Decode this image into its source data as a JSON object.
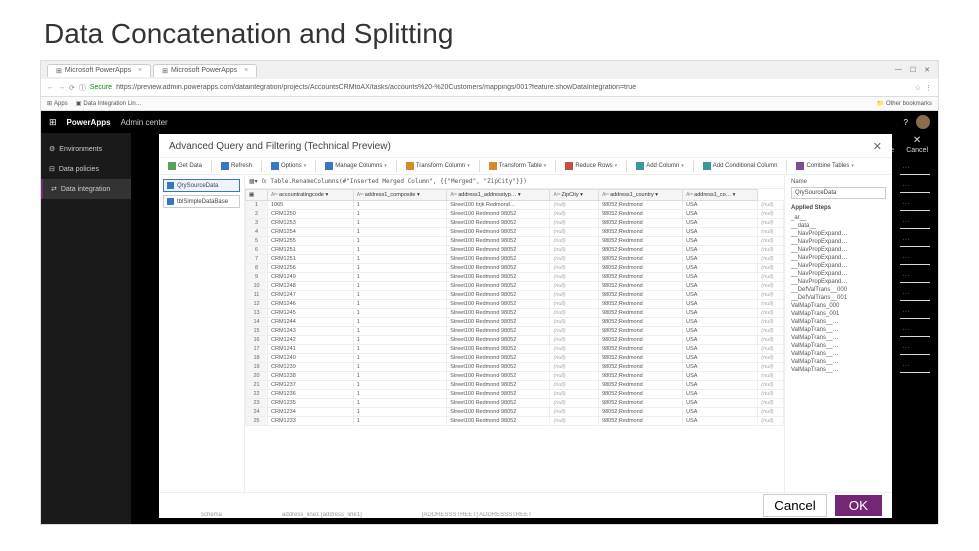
{
  "slide": {
    "title": "Data Concatenation and Splitting"
  },
  "browser": {
    "tabs": [
      {
        "label": "Microsoft PowerApps",
        "icon": "⊞"
      },
      {
        "label": "Microsoft PowerApps",
        "icon": "⊞"
      }
    ],
    "window_controls": {
      "min": "—",
      "max": "☐",
      "close": "✕"
    },
    "nav": {
      "back": "←",
      "forward": "→",
      "reload": "⟳",
      "secure": "Secure",
      "url": "https://preview.admin.powerapps.com/dataintegration/projects/AccountsCRMtoAX/tasks/accounts%20-%20Customers/mappings/001?feature.showDataIntegration=true",
      "star": "☆",
      "menu": "⋮"
    },
    "bookmarks": [
      {
        "icon": "⊞",
        "label": "Apps"
      },
      {
        "icon": "▣",
        "label": "Data Integration Lin…"
      }
    ],
    "other_bm": "Other bookmarks"
  },
  "app": {
    "brand": "PowerApps",
    "section": "Admin center",
    "help": "?",
    "nav": [
      {
        "icon": "⚙",
        "label": "Environments"
      },
      {
        "icon": "⊟",
        "label": "Data policies"
      },
      {
        "icon": "⇄",
        "label": "Data integration"
      }
    ],
    "float_actions": {
      "save": {
        "icon": "✓",
        "label": "Save"
      },
      "cancel": {
        "icon": "✕",
        "label": "Cancel"
      }
    }
  },
  "modal": {
    "title": "Advanced Query and Filtering (Technical Preview)",
    "close": "✕",
    "toolbar": [
      {
        "label": "Get Data",
        "color": "ico-green"
      },
      {
        "label": "Refresh",
        "color": "ico-blue"
      },
      {
        "label": "Options",
        "color": "ico-blue",
        "dd": true
      },
      {
        "label": "Manage Columns",
        "color": "ico-blue",
        "dd": true
      },
      {
        "label": "Transform Column",
        "color": "ico-orange",
        "dd": true
      },
      {
        "label": "Transform Table",
        "color": "ico-orange",
        "dd": true
      },
      {
        "label": "Reduce Rows",
        "color": "ico-red",
        "dd": true
      },
      {
        "label": "Add Column",
        "color": "ico-teal",
        "dd": true
      },
      {
        "label": "Add Conditional Column",
        "color": "ico-teal"
      },
      {
        "label": "Combine Tables",
        "color": "ico-purple",
        "dd": true
      }
    ],
    "sources": [
      {
        "name": "QrySourceData",
        "selected": true
      },
      {
        "name": "tblSimpleDataBase",
        "selected": false
      }
    ],
    "formula": "Table.RenameColumns(#\"Inserted Merged Column\", {{\"Merged\", \"ZipCity\"}})",
    "columns": [
      "",
      "accountratingcode",
      "address1_composite",
      "address1_addresstyp…",
      "ZipCity",
      "address1_country",
      "address1_co…"
    ],
    "rows": [
      [
        "1",
        "1065",
        "1",
        "Street100 hrjk Redmond…",
        "(null)",
        "98052;Redmond",
        "USA",
        "(null)"
      ],
      [
        "2",
        "CRM1250",
        "1",
        "Street100 Redmond 98052",
        "(null)",
        "98052;Redmond",
        "USA",
        "(null)"
      ],
      [
        "3",
        "CRM1253",
        "1",
        "Street100 Redmond 98052",
        "(null)",
        "98052;Redmond",
        "USA",
        "(null)"
      ],
      [
        "4",
        "CRM1254",
        "1",
        "Street100 Redmond 98052",
        "(null)",
        "98052;Redmond",
        "USA",
        "(null)"
      ],
      [
        "5",
        "CRM1255",
        "1",
        "Street100 Redmond 98052",
        "(null)",
        "98052;Redmond",
        "USA",
        "(null)"
      ],
      [
        "6",
        "CRM1251",
        "1",
        "Street100 Redmond 98052",
        "(null)",
        "98052;Redmond",
        "USA",
        "(null)"
      ],
      [
        "7",
        "CRM1251",
        "1",
        "Street100 Redmond 98052",
        "(null)",
        "98052;Redmond",
        "USA",
        "(null)"
      ],
      [
        "8",
        "CRM1256",
        "1",
        "Street100 Redmond 98052",
        "(null)",
        "98052;Redmond",
        "USA",
        "(null)"
      ],
      [
        "9",
        "CRM1249",
        "1",
        "Street100 Redmond 98052",
        "(null)",
        "98052;Redmond",
        "USA",
        "(null)"
      ],
      [
        "10",
        "CRM1248",
        "1",
        "Street100 Redmond 98052",
        "(null)",
        "98052;Redmond",
        "USA",
        "(null)"
      ],
      [
        "11",
        "CRM1247",
        "1",
        "Street100 Redmond 98052",
        "(null)",
        "98052;Redmond",
        "USA",
        "(null)"
      ],
      [
        "12",
        "CRM1246",
        "1",
        "Street100 Redmond 98052",
        "(null)",
        "98052;Redmond",
        "USA",
        "(null)"
      ],
      [
        "13",
        "CRM1245",
        "1",
        "Street100 Redmond 98052",
        "(null)",
        "98052;Redmond",
        "USA",
        "(null)"
      ],
      [
        "14",
        "CRM1244",
        "1",
        "Street100 Redmond 98052",
        "(null)",
        "98052;Redmond",
        "USA",
        "(null)"
      ],
      [
        "15",
        "CRM1243",
        "1",
        "Street100 Redmond 98052",
        "(null)",
        "98052;Redmond",
        "USA",
        "(null)"
      ],
      [
        "16",
        "CRM1242",
        "1",
        "Street100 Redmond 98052",
        "(null)",
        "98052;Redmond",
        "USA",
        "(null)"
      ],
      [
        "17",
        "CRM1241",
        "1",
        "Street100 Redmond 98052",
        "(null)",
        "98052;Redmond",
        "USA",
        "(null)"
      ],
      [
        "18",
        "CRM1240",
        "1",
        "Street100 Redmond 98052",
        "(null)",
        "98052;Redmond",
        "USA",
        "(null)"
      ],
      [
        "19",
        "CRM1239",
        "1",
        "Street100 Redmond 98052",
        "(null)",
        "98052;Redmond",
        "USA",
        "(null)"
      ],
      [
        "20",
        "CRM1238",
        "1",
        "Street100 Redmond 98052",
        "(null)",
        "98052;Redmond",
        "USA",
        "(null)"
      ],
      [
        "21",
        "CRM1237",
        "1",
        "Street100 Redmond 98052",
        "(null)",
        "98052;Redmond",
        "USA",
        "(null)"
      ],
      [
        "22",
        "CRM1236",
        "1",
        "Street100 Redmond 98052",
        "(null)",
        "98052;Redmond",
        "USA",
        "(null)"
      ],
      [
        "23",
        "CRM1235",
        "1",
        "Street100 Redmond 98052",
        "(null)",
        "98052;Redmond",
        "USA",
        "(null)"
      ],
      [
        "24",
        "CRM1234",
        "1",
        "Street100 Redmond 98052",
        "(null)",
        "98052;Redmond",
        "USA",
        "(null)"
      ],
      [
        "25",
        "CRM1233",
        "1",
        "Street100 Redmond 98052",
        "(null)",
        "98052;Redmond",
        "USA",
        "(null)"
      ]
    ],
    "right": {
      "name_label": "Name",
      "name_value": "QrySourceData",
      "steps_label": "Applied Steps",
      "steps": [
        "     _ar__",
        "     __data__",
        "     __NavPropExpand…",
        "     __NavPropExpand…",
        "     __NavPropExpand…",
        "     __NavPropExpand…",
        "     __NavPropExpand…",
        "     __NavPropExpand…",
        "     __NavPropExpand…",
        "     __DefValTrans__000",
        "     __DefValTrans__001",
        "     ValMapTrans_000",
        "     ValMapTrans_001",
        "     ValMapTrans__…",
        "     ValMapTrans__…",
        "     ValMapTrans__…",
        "     ValMapTrans__…",
        "     ValMapTrans__…",
        "     ValMapTrans__…",
        "     ValMapTrans__…"
      ]
    },
    "footer": {
      "cancel": "Cancel",
      "ok": "OK"
    }
  },
  "peek_right_rows": 12,
  "peek_bottom": [
    "schema",
    "address_line1 [address_line1]",
    "[ADDRESSSTREET] ADDRESSSTREET"
  ]
}
